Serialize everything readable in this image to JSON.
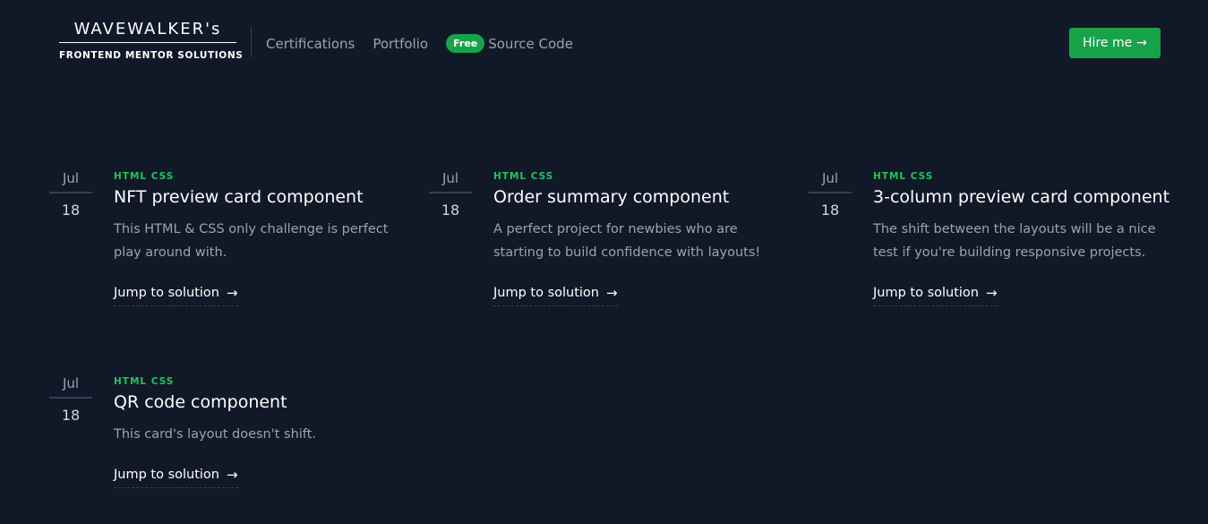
{
  "header": {
    "brand_title": "WAVEWALKER's",
    "brand_subtitle": "FRONTEND MENTOR SOLUTIONS",
    "nav": [
      "Certifications",
      "Portfolio"
    ],
    "source_badge": "Free",
    "source_label": "Source Code",
    "hire_label": "Hire me",
    "accent_color": "#16a34a"
  },
  "posts": [
    {
      "month": "Jul",
      "day": "18",
      "tags": "HTML CSS",
      "title": "NFT preview card component",
      "description": "This HTML & CSS only challenge is perfect play around with.",
      "link_label": "Jump to solution"
    },
    {
      "month": "Jul",
      "day": "18",
      "tags": "HTML CSS",
      "title": "Order summary component",
      "description": "A perfect project for newbies who are starting to build confidence with layouts!",
      "link_label": "Jump to solution"
    },
    {
      "month": "Jul",
      "day": "18",
      "tags": "HTML CSS",
      "title": "3-column preview card component",
      "description": "The shift between the layouts will be a nice test if you're building responsive projects.",
      "link_label": "Jump to solution"
    },
    {
      "month": "Jul",
      "day": "18",
      "tags": "HTML CSS",
      "title": "QR code component",
      "description": "This card's layout doesn't shift.",
      "link_label": "Jump to solution"
    }
  ]
}
